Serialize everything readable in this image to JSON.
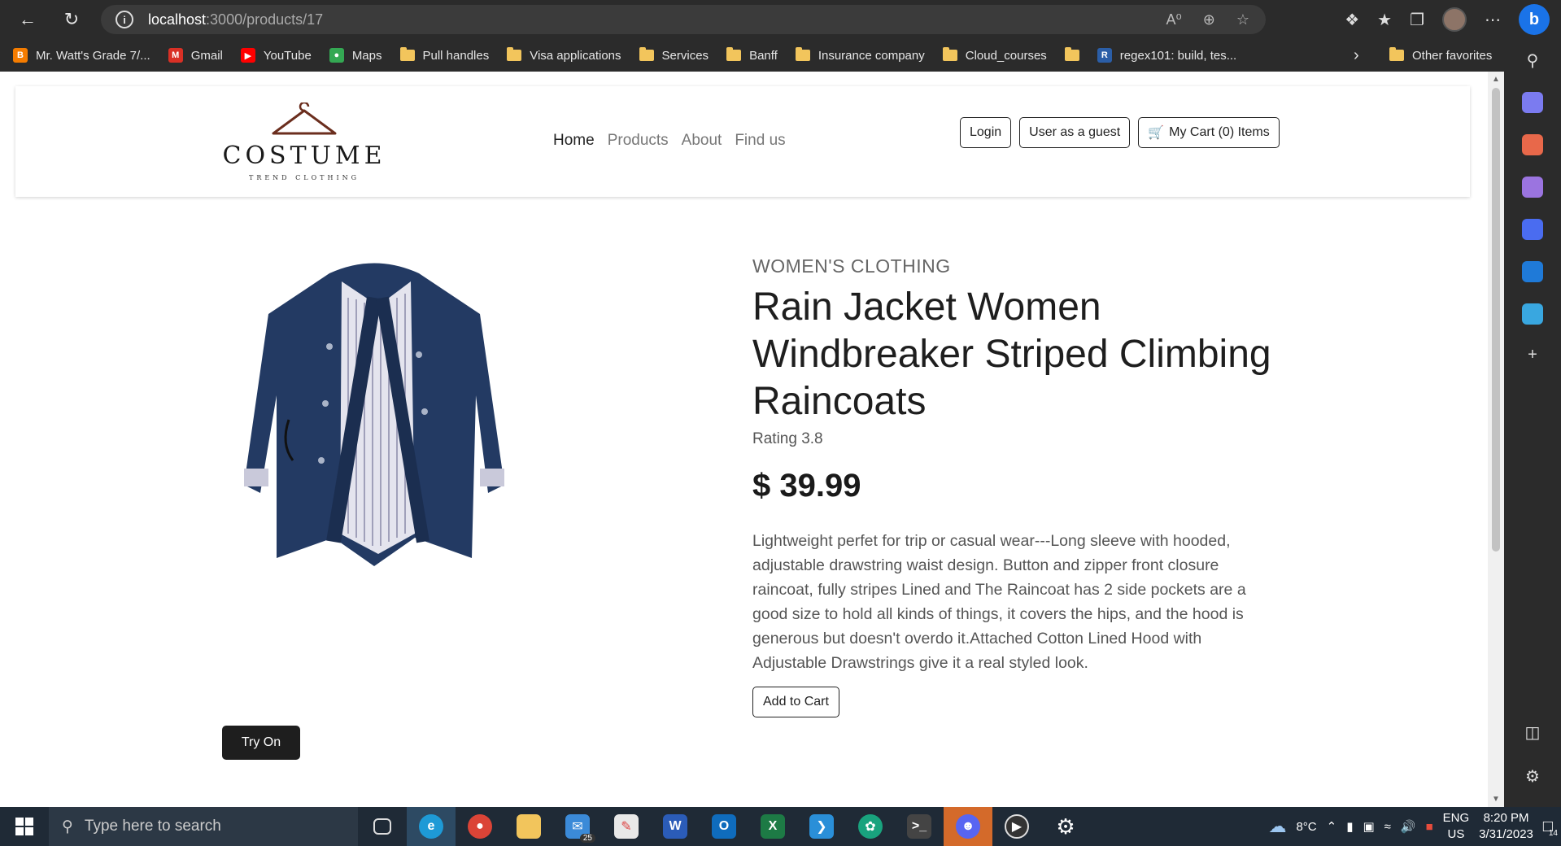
{
  "browser": {
    "url_host": "localhost",
    "url_path": ":3000/products/17",
    "bookmarks": [
      {
        "label": "Mr. Watt's Grade 7/...",
        "icon": "blogger-icon",
        "color": "#f57c00"
      },
      {
        "label": "Gmail",
        "icon": "gmail-icon",
        "color": "#d93025"
      },
      {
        "label": "YouTube",
        "icon": "youtube-icon",
        "color": "#ff0000"
      },
      {
        "label": "Maps",
        "icon": "maps-icon",
        "color": "#34a853"
      },
      {
        "label": "Pull handles",
        "icon": "folder-icon"
      },
      {
        "label": "Visa applications",
        "icon": "folder-icon"
      },
      {
        "label": "Services",
        "icon": "folder-icon"
      },
      {
        "label": "Banff",
        "icon": "folder-icon"
      },
      {
        "label": "Insurance company",
        "icon": "folder-icon"
      },
      {
        "label": "Cloud_courses",
        "icon": "folder-icon"
      },
      {
        "label": "",
        "icon": "folder-icon"
      },
      {
        "label": "regex101: build, tes...",
        "icon": "regex-icon",
        "color": "#2b5ea7"
      }
    ],
    "other_favorites": "Other favorites"
  },
  "site": {
    "logo_word": "COSTUME",
    "logo_tagline": "TREND CLOTHING",
    "nav": {
      "home": "Home",
      "products": "Products",
      "about": "About",
      "find_us": "Find us"
    },
    "buttons": {
      "login": "Login",
      "guest": "User as a guest",
      "cart": "My Cart (0) Items"
    }
  },
  "product": {
    "category": "WOMEN'S CLOTHING",
    "title": "Rain Jacket Women Windbreaker Striped Climbing Raincoats",
    "rating": "Rating 3.8",
    "price": "$ 39.99",
    "description": "Lightweight perfet for trip or casual wear---Long sleeve with hooded, adjustable drawstring waist design. Button and zipper front closure raincoat, fully stripes Lined and The Raincoat has 2 side pockets are a good size to hold all kinds of things, it covers the hips, and the hood is generous but doesn't overdo it.Attached Cotton Lined Hood with Adjustable Drawstrings give it a real styled look.",
    "add_to_cart": "Add to Cart",
    "try_on": "Try On"
  },
  "taskbar": {
    "search_placeholder": "Type here to search",
    "mail_badge": "25",
    "weather": "8°C",
    "lang": "ENG",
    "region": "US",
    "time": "8:20 PM",
    "date": "3/31/2023",
    "notifications": "14"
  }
}
